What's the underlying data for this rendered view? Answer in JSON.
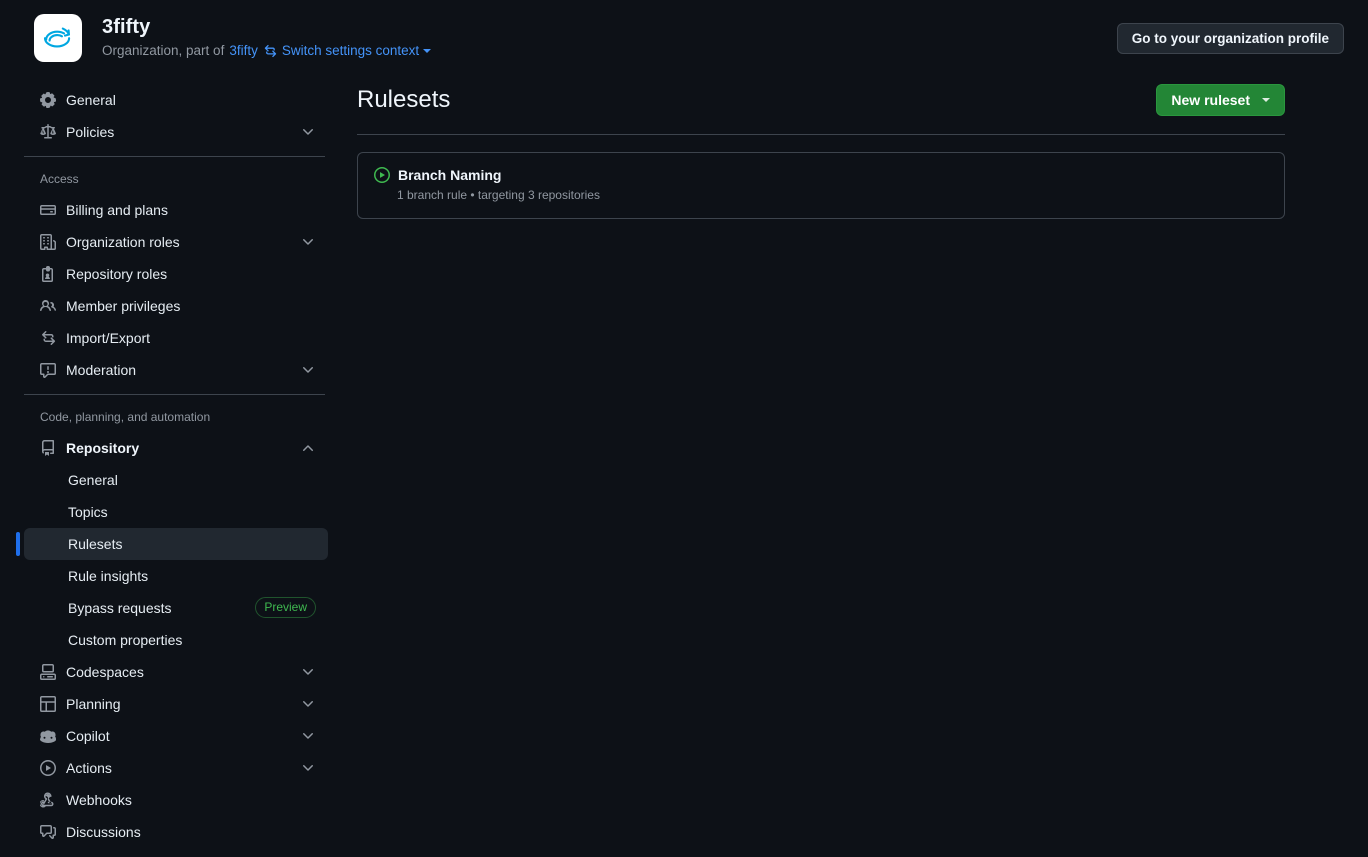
{
  "header": {
    "org_name": "3fifty",
    "subtitle_prefix": "Organization, part of",
    "parent_org": "3fifty",
    "switch_context": "Switch settings context",
    "profile_button": "Go to your organization profile",
    "logo_icon": "swirl-logo-icon",
    "swap_icon": "arrow-switch-icon"
  },
  "sidebar": {
    "top_items": [
      {
        "label": "General",
        "icon": "gear-icon",
        "expandable": false
      },
      {
        "label": "Policies",
        "icon": "law-icon",
        "expandable": true
      }
    ],
    "access_section": {
      "label": "Access",
      "items": [
        {
          "label": "Billing and plans",
          "icon": "credit-card-icon",
          "expandable": false
        },
        {
          "label": "Organization roles",
          "icon": "organization-icon",
          "expandable": true
        },
        {
          "label": "Repository roles",
          "icon": "id-badge-icon",
          "expandable": false
        },
        {
          "label": "Member privileges",
          "icon": "people-icon",
          "expandable": false
        },
        {
          "label": "Import/Export",
          "icon": "arrow-switch-icon",
          "expandable": false
        },
        {
          "label": "Moderation",
          "icon": "report-icon",
          "expandable": true
        }
      ]
    },
    "code_section": {
      "label": "Code, planning, and automation",
      "items": [
        {
          "label": "Repository",
          "icon": "repo-icon",
          "expandable": true,
          "expanded": true,
          "bold": true
        },
        {
          "label": "Codespaces",
          "icon": "codespaces-icon",
          "expandable": true
        },
        {
          "label": "Planning",
          "icon": "project-icon",
          "expandable": true
        },
        {
          "label": "Copilot",
          "icon": "copilot-icon",
          "expandable": true
        },
        {
          "label": "Actions",
          "icon": "play-icon",
          "expandable": true
        },
        {
          "label": "Webhooks",
          "icon": "webhook-icon",
          "expandable": false
        },
        {
          "label": "Discussions",
          "icon": "comment-discussion-icon",
          "expandable": false
        }
      ]
    },
    "repository_subitems": [
      {
        "label": "General",
        "active": false,
        "badge": null
      },
      {
        "label": "Topics",
        "active": false,
        "badge": null
      },
      {
        "label": "Rulesets",
        "active": true,
        "badge": null
      },
      {
        "label": "Rule insights",
        "active": false,
        "badge": null
      },
      {
        "label": "Bypass requests",
        "active": false,
        "badge": "Preview"
      },
      {
        "label": "Custom properties",
        "active": false,
        "badge": null
      }
    ]
  },
  "main": {
    "title": "Rulesets",
    "new_ruleset_label": "New ruleset",
    "rulesets": [
      {
        "name": "Branch Naming",
        "status_icon": "active-play-circle-icon",
        "detail": "1 branch rule • targeting 3 repositories"
      }
    ]
  },
  "colors": {
    "background": "#0d1117",
    "border": "#3d444d",
    "accent_blue": "#4493f8",
    "active_indicator": "#1f6feb",
    "green_button": "#238636",
    "green_status": "#3fb950",
    "muted_text": "#9198a1"
  }
}
